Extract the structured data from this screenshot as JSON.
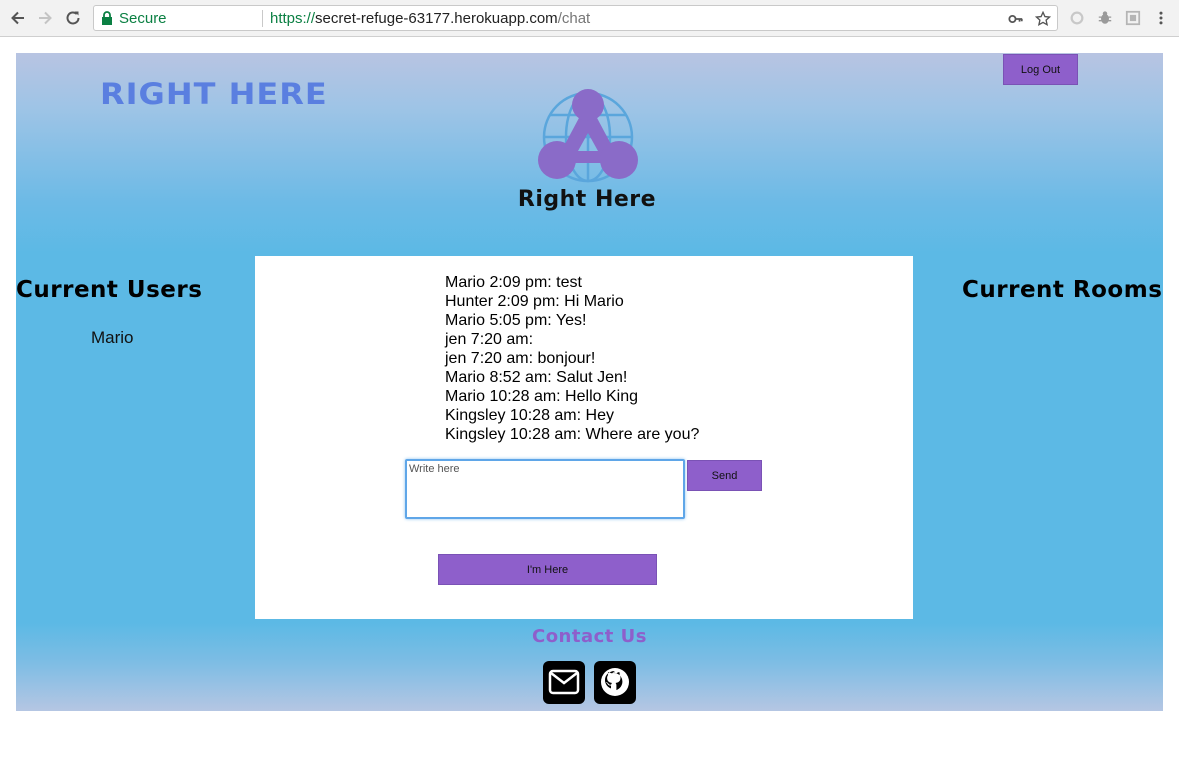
{
  "browser": {
    "secure_label": "Secure",
    "url_scheme": "https://",
    "url_host": "secret-refuge-63177.herokuapp.com",
    "url_path": "/chat"
  },
  "header": {
    "brand": "RIGHT HERE",
    "logout_label": "Log Out",
    "logo_title": "Right Here"
  },
  "users": {
    "heading": "Current Users",
    "list": [
      "Mario"
    ]
  },
  "rooms": {
    "heading": "Current Rooms"
  },
  "chat": {
    "messages": [
      "Mario 2:09 pm: test",
      "Hunter 2:09 pm: Hi Mario",
      "Mario 5:05 pm: Yes!",
      "jen 7:20 am:",
      "jen 7:20 am: bonjour!",
      "Mario 8:52 am: Salut Jen!",
      "Mario 10:28 am: Hello King",
      "Kingsley 10:28 am: Hey",
      "Kingsley 10:28 am: Where are you?"
    ],
    "input_placeholder": "Write here",
    "send_label": "Send",
    "here_label": "I'm Here"
  },
  "footer": {
    "contact_heading": "Contact Us",
    "icons": [
      "envelope-icon",
      "github-icon"
    ]
  },
  "colors": {
    "accent": "#8e5fcb",
    "brand": "#5a7fe0",
    "page_bg": "#5cb9e5"
  }
}
